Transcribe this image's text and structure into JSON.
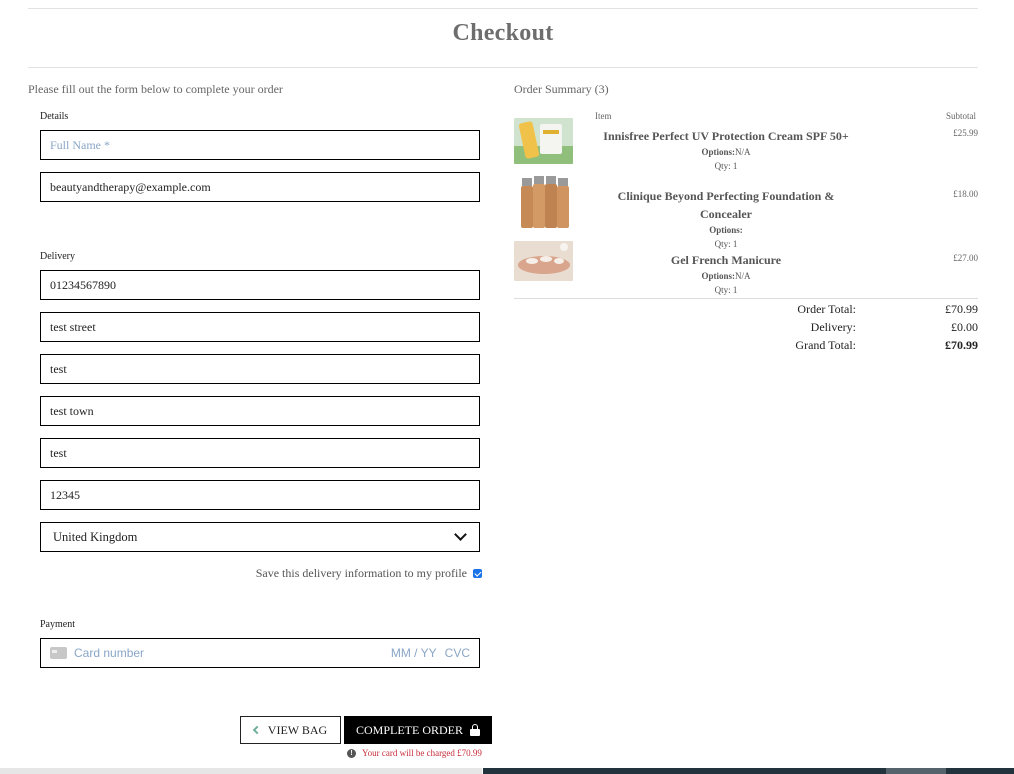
{
  "page": {
    "title": "Checkout",
    "intro": "Please fill out the form below to complete your order"
  },
  "details": {
    "label": "Details",
    "full_name": {
      "value": "",
      "placeholder": "Full Name *"
    },
    "email": {
      "value": "beautyandtherapy@example.com"
    }
  },
  "delivery": {
    "label": "Delivery",
    "phone": "01234567890",
    "street1": "test street",
    "street2": "test",
    "town": "test town",
    "county": "test",
    "postcode": "12345",
    "country": "United Kingdom",
    "save_label": "Save this delivery information to my profile",
    "save_checked": true
  },
  "payment": {
    "label": "Payment",
    "card_placeholder": "Card number",
    "expiry_placeholder": "MM / YY",
    "cvc_placeholder": "CVC"
  },
  "actions": {
    "back_label": "VIEW BAG",
    "complete_label": "COMPLETE ORDER",
    "charge_note": "Your card will be charged £70.99"
  },
  "summary": {
    "title": "Order Summary (3)",
    "col_item": "Item",
    "col_subtotal": "Subtotal",
    "items": [
      {
        "name": "Innisfree Perfect UV Protection Cream SPF 50+",
        "options_label": "Options:",
        "options_value": "N/A",
        "qty": "Qty: 1",
        "price": "£25.99"
      },
      {
        "name": "Clinique Beyond Perfecting Foundation & Concealer",
        "options_label": "Options:",
        "options_value": "",
        "qty": "Qty: 1",
        "price": "£18.00"
      },
      {
        "name": "Gel French Manicure",
        "options_label": "Options:",
        "options_value": "N/A",
        "qty": "Qty: 1",
        "price": "£27.00"
      }
    ],
    "order_total_label": "Order Total:",
    "order_total": "£70.99",
    "delivery_label": "Delivery:",
    "delivery": "£0.00",
    "grand_total_label": "Grand Total:",
    "grand_total": "£70.99"
  },
  "colors": {
    "accent_check": "#1a73e8",
    "charge_note": "#c62c3a",
    "placeholder": "#8aa6c6"
  }
}
